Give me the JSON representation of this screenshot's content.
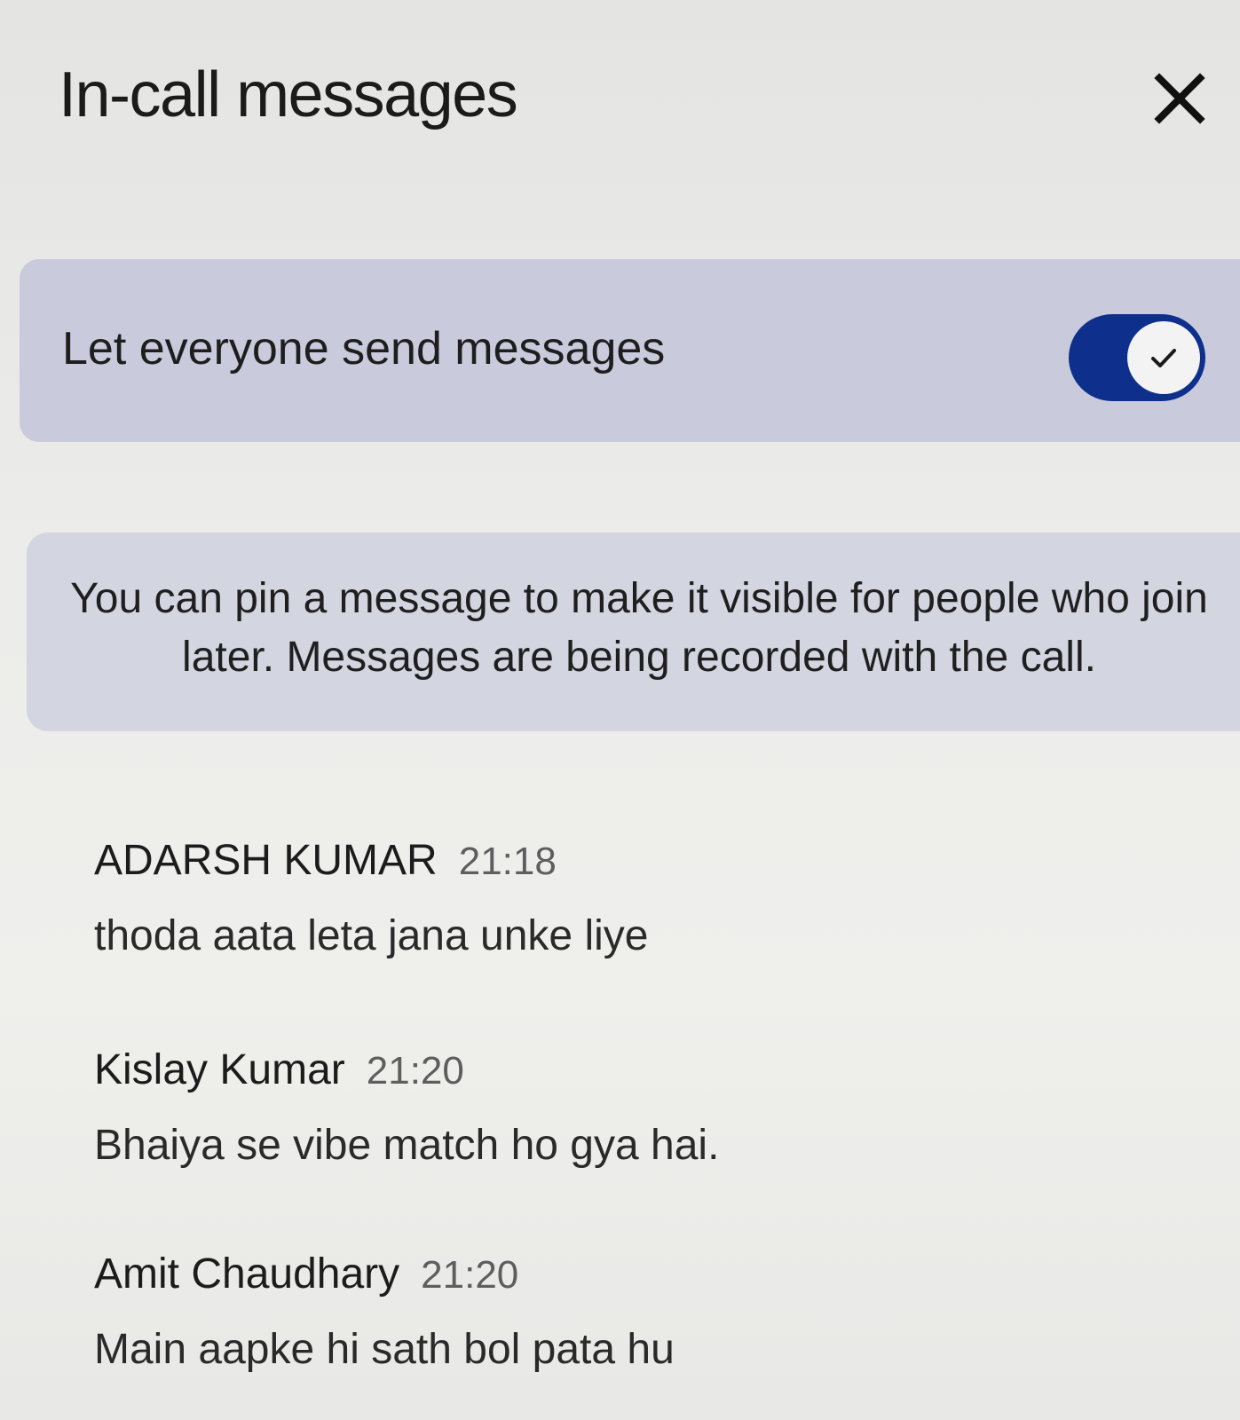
{
  "header": {
    "title": "In-call messages",
    "close_icon": "close-icon"
  },
  "settings": {
    "toggle_label": "Let everyone send messages",
    "toggle_on": true,
    "toggle_color": "#0e2f8c",
    "check_icon": "check-icon"
  },
  "info": {
    "text": "You can pin a message to make it visible for people who join later. Messages are being recorded with the call."
  },
  "messages": [
    {
      "sender": "ADARSH KUMAR",
      "time": "21:18",
      "text": "thoda aata leta jana unke liye"
    },
    {
      "sender": "Kislay Kumar",
      "time": "21:20",
      "text": "Bhaiya se vibe match ho gya hai."
    },
    {
      "sender": "Amit Chaudhary",
      "time": "21:20",
      "text": "Main aapke hi sath bol pata hu"
    }
  ]
}
